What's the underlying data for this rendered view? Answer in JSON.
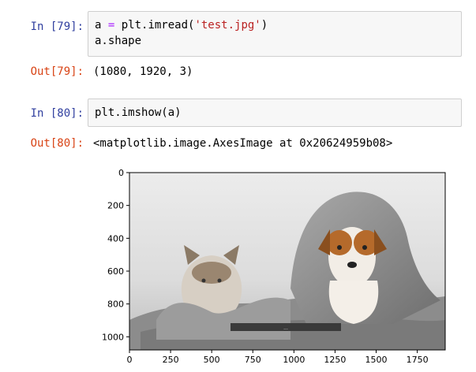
{
  "cells": [
    {
      "in_prompt": "In  [79]:",
      "code_lines": [
        [
          {
            "t": "a ",
            "c": "name"
          },
          {
            "t": "=",
            "c": "op"
          },
          {
            "t": " plt.imread(",
            "c": "name"
          },
          {
            "t": "'test.jpg'",
            "c": "str"
          },
          {
            "t": ")",
            "c": "name"
          }
        ],
        [
          {
            "t": "a.shape",
            "c": "name"
          }
        ]
      ],
      "out_prompt": "Out[79]:",
      "output_text": "(1080, 1920, 3)"
    },
    {
      "in_prompt": "In  [80]:",
      "code_lines": [
        [
          {
            "t": "plt.imshow(",
            "c": "name"
          },
          {
            "t": "a",
            "c": "name"
          },
          {
            "t": ")",
            "c": "name"
          }
        ]
      ],
      "out_prompt": "Out[80]:",
      "output_text": "<matplotlib.image.AxesImage at 0x20624959b08>"
    }
  ],
  "figure": {
    "image_alt": "image",
    "x_ticks": [
      "0",
      "250",
      "500",
      "750",
      "1000",
      "1250",
      "1500",
      "1750"
    ],
    "y_ticks": [
      "0",
      "200",
      "400",
      "600",
      "800",
      "1000"
    ],
    "xlim": [
      0,
      1920
    ],
    "ylim": [
      1080,
      0
    ],
    "caption_overlay": "..."
  }
}
